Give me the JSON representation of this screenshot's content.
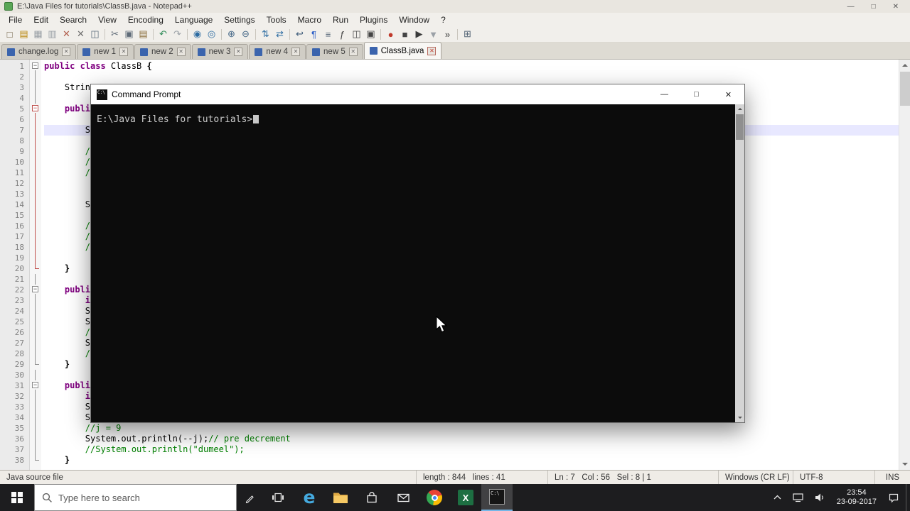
{
  "titlebar": {
    "title": "E:\\Java Files for tutorials\\ClassB.java - Notepad++",
    "controls": {
      "minimize": "—",
      "maximize": "□",
      "close": "✕"
    }
  },
  "menubar": {
    "items": [
      "File",
      "Edit",
      "Search",
      "View",
      "Encoding",
      "Language",
      "Settings",
      "Tools",
      "Macro",
      "Run",
      "Plugins",
      "Window",
      "?"
    ]
  },
  "toolbar": {
    "icons": [
      {
        "name": "new-file-icon",
        "glyph": "□",
        "color": "#6b5b3e"
      },
      {
        "name": "open-file-icon",
        "glyph": "▤",
        "color": "#b8860b"
      },
      {
        "name": "save-icon",
        "glyph": "▦",
        "color": "#9aa0a6"
      },
      {
        "name": "save-all-icon",
        "glyph": "▥",
        "color": "#9aa0a6"
      },
      {
        "name": "close-file-icon",
        "glyph": "✕",
        "color": "#b05c4a"
      },
      {
        "name": "close-all-icon",
        "glyph": "✕",
        "color": "#6d6d6d"
      },
      {
        "name": "print-icon",
        "glyph": "◫",
        "color": "#5a6b7a"
      },
      {
        "sep": true
      },
      {
        "name": "cut-icon",
        "glyph": "✂",
        "color": "#5f6b78"
      },
      {
        "name": "copy-icon",
        "glyph": "▣",
        "color": "#5f6b78"
      },
      {
        "name": "paste-icon",
        "glyph": "▤",
        "color": "#8a6d3b"
      },
      {
        "sep": true
      },
      {
        "name": "undo-icon",
        "glyph": "↶",
        "color": "#2e8b57"
      },
      {
        "name": "redo-icon",
        "glyph": "↷",
        "color": "#9aa0a6"
      },
      {
        "sep": true
      },
      {
        "name": "find-icon",
        "glyph": "◉",
        "color": "#2d6ca2"
      },
      {
        "name": "replace-icon",
        "glyph": "◎",
        "color": "#2d6ca2"
      },
      {
        "sep": true
      },
      {
        "name": "zoom-in-icon",
        "glyph": "⊕",
        "color": "#4a6b8a"
      },
      {
        "name": "zoom-out-icon",
        "glyph": "⊖",
        "color": "#4a6b8a"
      },
      {
        "sep": true
      },
      {
        "name": "sync-vertical-icon",
        "glyph": "⇅",
        "color": "#2d6ca2"
      },
      {
        "name": "sync-horizontal-icon",
        "glyph": "⇄",
        "color": "#2d6ca2"
      },
      {
        "sep": true
      },
      {
        "name": "word-wrap-icon",
        "glyph": "↩",
        "color": "#3c5a78"
      },
      {
        "name": "show-all-chars-icon",
        "glyph": "¶",
        "color": "#2d5fc7"
      },
      {
        "name": "indent-guide-icon",
        "glyph": "≡",
        "color": "#556677"
      },
      {
        "name": "function-list-icon",
        "glyph": "ƒ",
        "color": "#444444"
      },
      {
        "name": "doc-map-icon",
        "glyph": "◫",
        "color": "#444444"
      },
      {
        "name": "doc-switcher-icon",
        "glyph": "▣",
        "color": "#444444"
      },
      {
        "sep": true
      },
      {
        "name": "start-record-macro-icon",
        "glyph": "●",
        "color": "#c0392b"
      },
      {
        "name": "stop-record-macro-icon",
        "glyph": "■",
        "color": "#444444"
      },
      {
        "name": "play-macro-icon",
        "glyph": "▶",
        "color": "#3a3a3a"
      },
      {
        "name": "save-macro-icon",
        "glyph": "▼",
        "color": "#9aa0a6"
      },
      {
        "name": "run-macro-multiple-icon",
        "glyph": "»",
        "color": "#3a3a3a"
      },
      {
        "sep": true
      },
      {
        "name": "plugin-grid-icon",
        "glyph": "⊞",
        "color": "#556677"
      }
    ]
  },
  "tabbar": {
    "tabs": [
      {
        "label": "change.log",
        "active": false
      },
      {
        "label": "new 1",
        "active": false
      },
      {
        "label": "new 2",
        "active": false
      },
      {
        "label": "new 3",
        "active": false
      },
      {
        "label": "new 4",
        "active": false
      },
      {
        "label": "new 5",
        "active": false
      },
      {
        "label": "ClassB.java",
        "active": true
      }
    ]
  },
  "editor": {
    "current_line": 7,
    "lines": [
      {
        "n": 1,
        "fold": "box",
        "fc": "g",
        "segs": [
          [
            "kw",
            "public class"
          ],
          [
            "plain",
            " ClassB "
          ],
          [
            "op",
            "{"
          ]
        ]
      },
      {
        "n": 2,
        "fold": "line",
        "fc": "g",
        "segs": []
      },
      {
        "n": 3,
        "fold": "line",
        "fc": "g",
        "segs": [
          [
            "plain",
            "    Strin"
          ]
        ]
      },
      {
        "n": 4,
        "fold": "line",
        "fc": "g",
        "segs": []
      },
      {
        "n": 5,
        "fold": "box",
        "fc": "r",
        "segs": [
          [
            "kw",
            "    publi"
          ]
        ]
      },
      {
        "n": 6,
        "fold": "line",
        "fc": "r",
        "segs": []
      },
      {
        "n": 7,
        "fold": "line",
        "fc": "r",
        "segs": [
          [
            "plain",
            "        S"
          ]
        ]
      },
      {
        "n": 8,
        "fold": "line",
        "fc": "r",
        "segs": []
      },
      {
        "n": 9,
        "fold": "line",
        "fc": "r",
        "segs": [
          [
            "cmt",
            "        //"
          ]
        ]
      },
      {
        "n": 10,
        "fold": "line",
        "fc": "r",
        "segs": [
          [
            "cmt",
            "        //"
          ]
        ]
      },
      {
        "n": 11,
        "fold": "line",
        "fc": "r",
        "segs": [
          [
            "cmt",
            "        //"
          ]
        ]
      },
      {
        "n": 12,
        "fold": "line",
        "fc": "r",
        "segs": []
      },
      {
        "n": 13,
        "fold": "line",
        "fc": "r",
        "segs": []
      },
      {
        "n": 14,
        "fold": "line",
        "fc": "r",
        "segs": [
          [
            "plain",
            "        S"
          ]
        ]
      },
      {
        "n": 15,
        "fold": "line",
        "fc": "r",
        "segs": []
      },
      {
        "n": 16,
        "fold": "line",
        "fc": "r",
        "segs": [
          [
            "cmt",
            "        //"
          ]
        ]
      },
      {
        "n": 17,
        "fold": "line",
        "fc": "r",
        "segs": [
          [
            "cmt",
            "        //"
          ]
        ]
      },
      {
        "n": 18,
        "fold": "line",
        "fc": "r",
        "segs": [
          [
            "cmt",
            "        //"
          ]
        ]
      },
      {
        "n": 19,
        "fold": "line",
        "fc": "r",
        "segs": []
      },
      {
        "n": 20,
        "fold": "end",
        "fc": "r",
        "segs": [
          [
            "op",
            "    }"
          ]
        ]
      },
      {
        "n": 21,
        "fold": "line",
        "fc": "g",
        "segs": []
      },
      {
        "n": 22,
        "fold": "box",
        "fc": "g",
        "segs": [
          [
            "kw",
            "    publi"
          ]
        ]
      },
      {
        "n": 23,
        "fold": "line",
        "fc": "g",
        "segs": [
          [
            "kw",
            "        i"
          ]
        ]
      },
      {
        "n": 24,
        "fold": "line",
        "fc": "g",
        "segs": [
          [
            "plain",
            "        S"
          ]
        ]
      },
      {
        "n": 25,
        "fold": "line",
        "fc": "g",
        "segs": [
          [
            "plain",
            "        S"
          ]
        ]
      },
      {
        "n": 26,
        "fold": "line",
        "fc": "g",
        "segs": [
          [
            "cmt",
            "        //"
          ]
        ]
      },
      {
        "n": 27,
        "fold": "line",
        "fc": "g",
        "segs": [
          [
            "plain",
            "        S"
          ]
        ]
      },
      {
        "n": 28,
        "fold": "line",
        "fc": "g",
        "segs": [
          [
            "cmt",
            "        //"
          ]
        ]
      },
      {
        "n": 29,
        "fold": "end",
        "fc": "g",
        "segs": [
          [
            "op",
            "    }"
          ]
        ]
      },
      {
        "n": 30,
        "fold": "line",
        "fc": "g",
        "segs": []
      },
      {
        "n": 31,
        "fold": "box",
        "fc": "g",
        "segs": [
          [
            "kw",
            "    publi"
          ]
        ]
      },
      {
        "n": 32,
        "fold": "line",
        "fc": "g",
        "segs": [
          [
            "kw",
            "        i"
          ]
        ]
      },
      {
        "n": 33,
        "fold": "line",
        "fc": "g",
        "segs": [
          [
            "plain",
            "        S"
          ]
        ]
      },
      {
        "n": 34,
        "fold": "line",
        "fc": "g",
        "segs": [
          [
            "plain",
            "        S"
          ]
        ]
      },
      {
        "n": 35,
        "fold": "line",
        "fc": "g",
        "segs": [
          [
            "cmt",
            "        //j = 9"
          ]
        ]
      },
      {
        "n": 36,
        "fold": "line",
        "fc": "g",
        "segs": [
          [
            "plain",
            "        System.out.println(--j);"
          ],
          [
            "cmt",
            "// pre decrement"
          ]
        ]
      },
      {
        "n": 37,
        "fold": "line",
        "fc": "g",
        "segs": [
          [
            "cmt",
            "        //System.out.println(\"dumeel\");"
          ]
        ]
      },
      {
        "n": 38,
        "fold": "end",
        "fc": "g",
        "segs": [
          [
            "op",
            "    }"
          ]
        ]
      }
    ]
  },
  "cmd": {
    "title": "Command Prompt",
    "icon_label": "C:\\",
    "prompt": "E:\\Java Files for tutorials>",
    "controls": {
      "minimize": "—",
      "maximize": "□",
      "close": "✕"
    }
  },
  "statusbar": {
    "doctype": "Java source file",
    "length_info": "length : 844   lines : 41",
    "cursor_info": "Ln : 7   Col : 56   Sel : 8 | 1",
    "eol": "Windows (CR LF)",
    "encoding": "UTF-8",
    "mode": "INS"
  },
  "taskbar": {
    "search_text": "Type here to search",
    "edge_glyph": "e",
    "excel_glyph": "X",
    "cmd_glyph": "C:\\",
    "clock": {
      "time": "23:54",
      "date": "23-09-2017"
    }
  }
}
